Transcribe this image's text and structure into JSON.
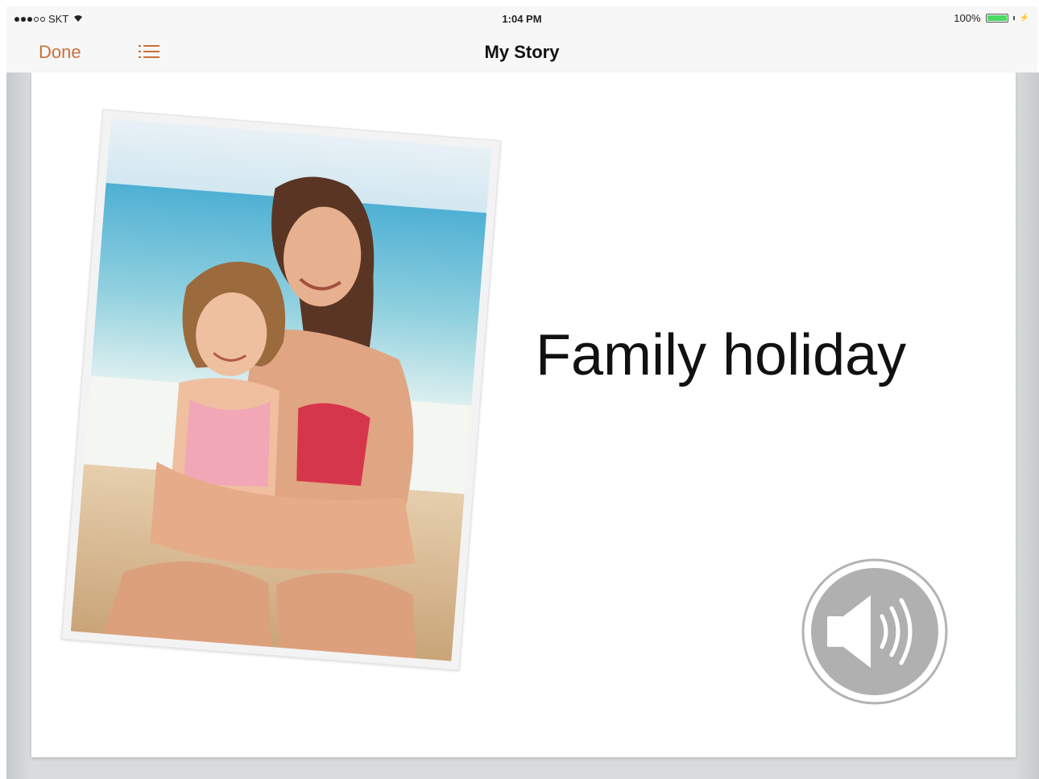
{
  "status_bar": {
    "carrier": "SKT",
    "time": "1:04 PM",
    "battery_percent": "100%",
    "battery_level": 1.0
  },
  "nav": {
    "done_label": "Done",
    "title": "My Story",
    "list_icon": "list-icon"
  },
  "page": {
    "caption": "Family holiday",
    "photo_icon": "photo",
    "speaker_icon": "speaker-icon"
  },
  "colors": {
    "accent": "#c8703a",
    "battery": "#4cd964",
    "speaker_gray": "#aaaaaa"
  }
}
